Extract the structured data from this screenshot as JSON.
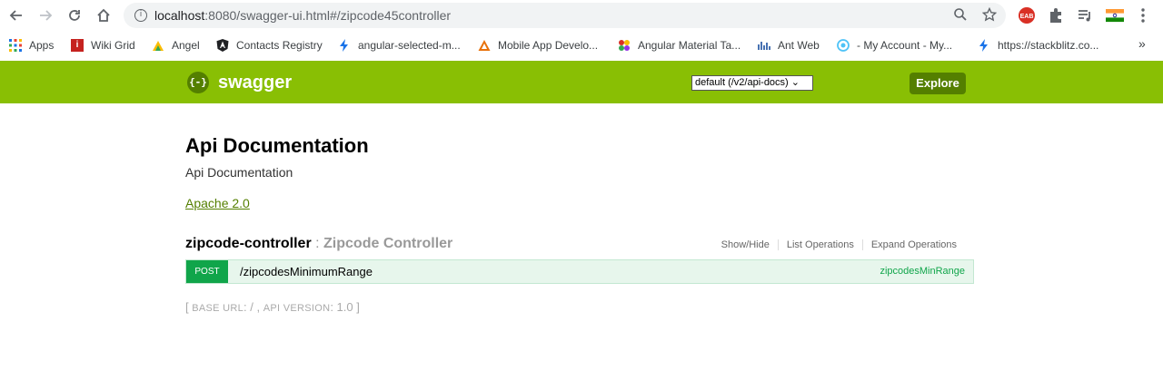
{
  "browser": {
    "url_host": "localhost",
    "url_rest": ":8080/swagger-ui.html#/zipcode45controller",
    "icons": [
      "back-icon",
      "forward-icon",
      "reload-icon",
      "home-icon",
      "info-icon",
      "search-icon",
      "star-icon",
      "extensions-icon",
      "reading-list-icon",
      "menu-icon"
    ]
  },
  "bookmarks": [
    {
      "label": "Apps",
      "icon": "apps-icon",
      "color": "#e94235"
    },
    {
      "label": "Wiki Grid",
      "icon": "wiki-icon",
      "color": "#c5221f"
    },
    {
      "label": "Angel",
      "icon": "angel-icon",
      "color": "#34a853"
    },
    {
      "label": "Contacts Registry",
      "icon": "angular-icon",
      "color": "#202124"
    },
    {
      "label": "angular-selected-m...",
      "icon": "bolt-icon",
      "color": "#1a73e8"
    },
    {
      "label": "Mobile App Develo...",
      "icon": "triangle-icon",
      "color": "#e8710a"
    },
    {
      "label": "Angular Material Ta...",
      "icon": "material-icon",
      "color": "#d93025"
    },
    {
      "label": "Ant Web",
      "icon": "ant-icon",
      "color": "#1a4fa0"
    },
    {
      "label": "- My Account - My...",
      "icon": "account-icon",
      "color": "#4fc3f7"
    },
    {
      "label": "https://stackblitz.co...",
      "icon": "bolt-icon",
      "color": "#1a73e8"
    }
  ],
  "bookmarks_overflow": "»",
  "header": {
    "logo_mark": "{-}",
    "logo_text": "swagger",
    "spec_select": "default (/v2/api-docs) ⌄",
    "explore_label": "Explore",
    "bg_color": "#89bf04"
  },
  "info": {
    "title": "Api Documentation",
    "description": "Api Documentation",
    "license": "Apache 2.0"
  },
  "resource": {
    "name": "zipcode-controller",
    "separator": " : ",
    "description": "Zipcode Controller",
    "links": [
      "Show/Hide",
      "List Operations",
      "Expand Operations"
    ]
  },
  "operation": {
    "method": "POST",
    "path": "/zipcodesMinimumRange",
    "nickname": "zipcodesMinRange"
  },
  "footer": {
    "open": "[ ",
    "base_url_key": "BASE URL",
    "base_url_value": ": / , ",
    "api_version_key": "API VERSION",
    "api_version_value": ": 1.0 ]"
  }
}
